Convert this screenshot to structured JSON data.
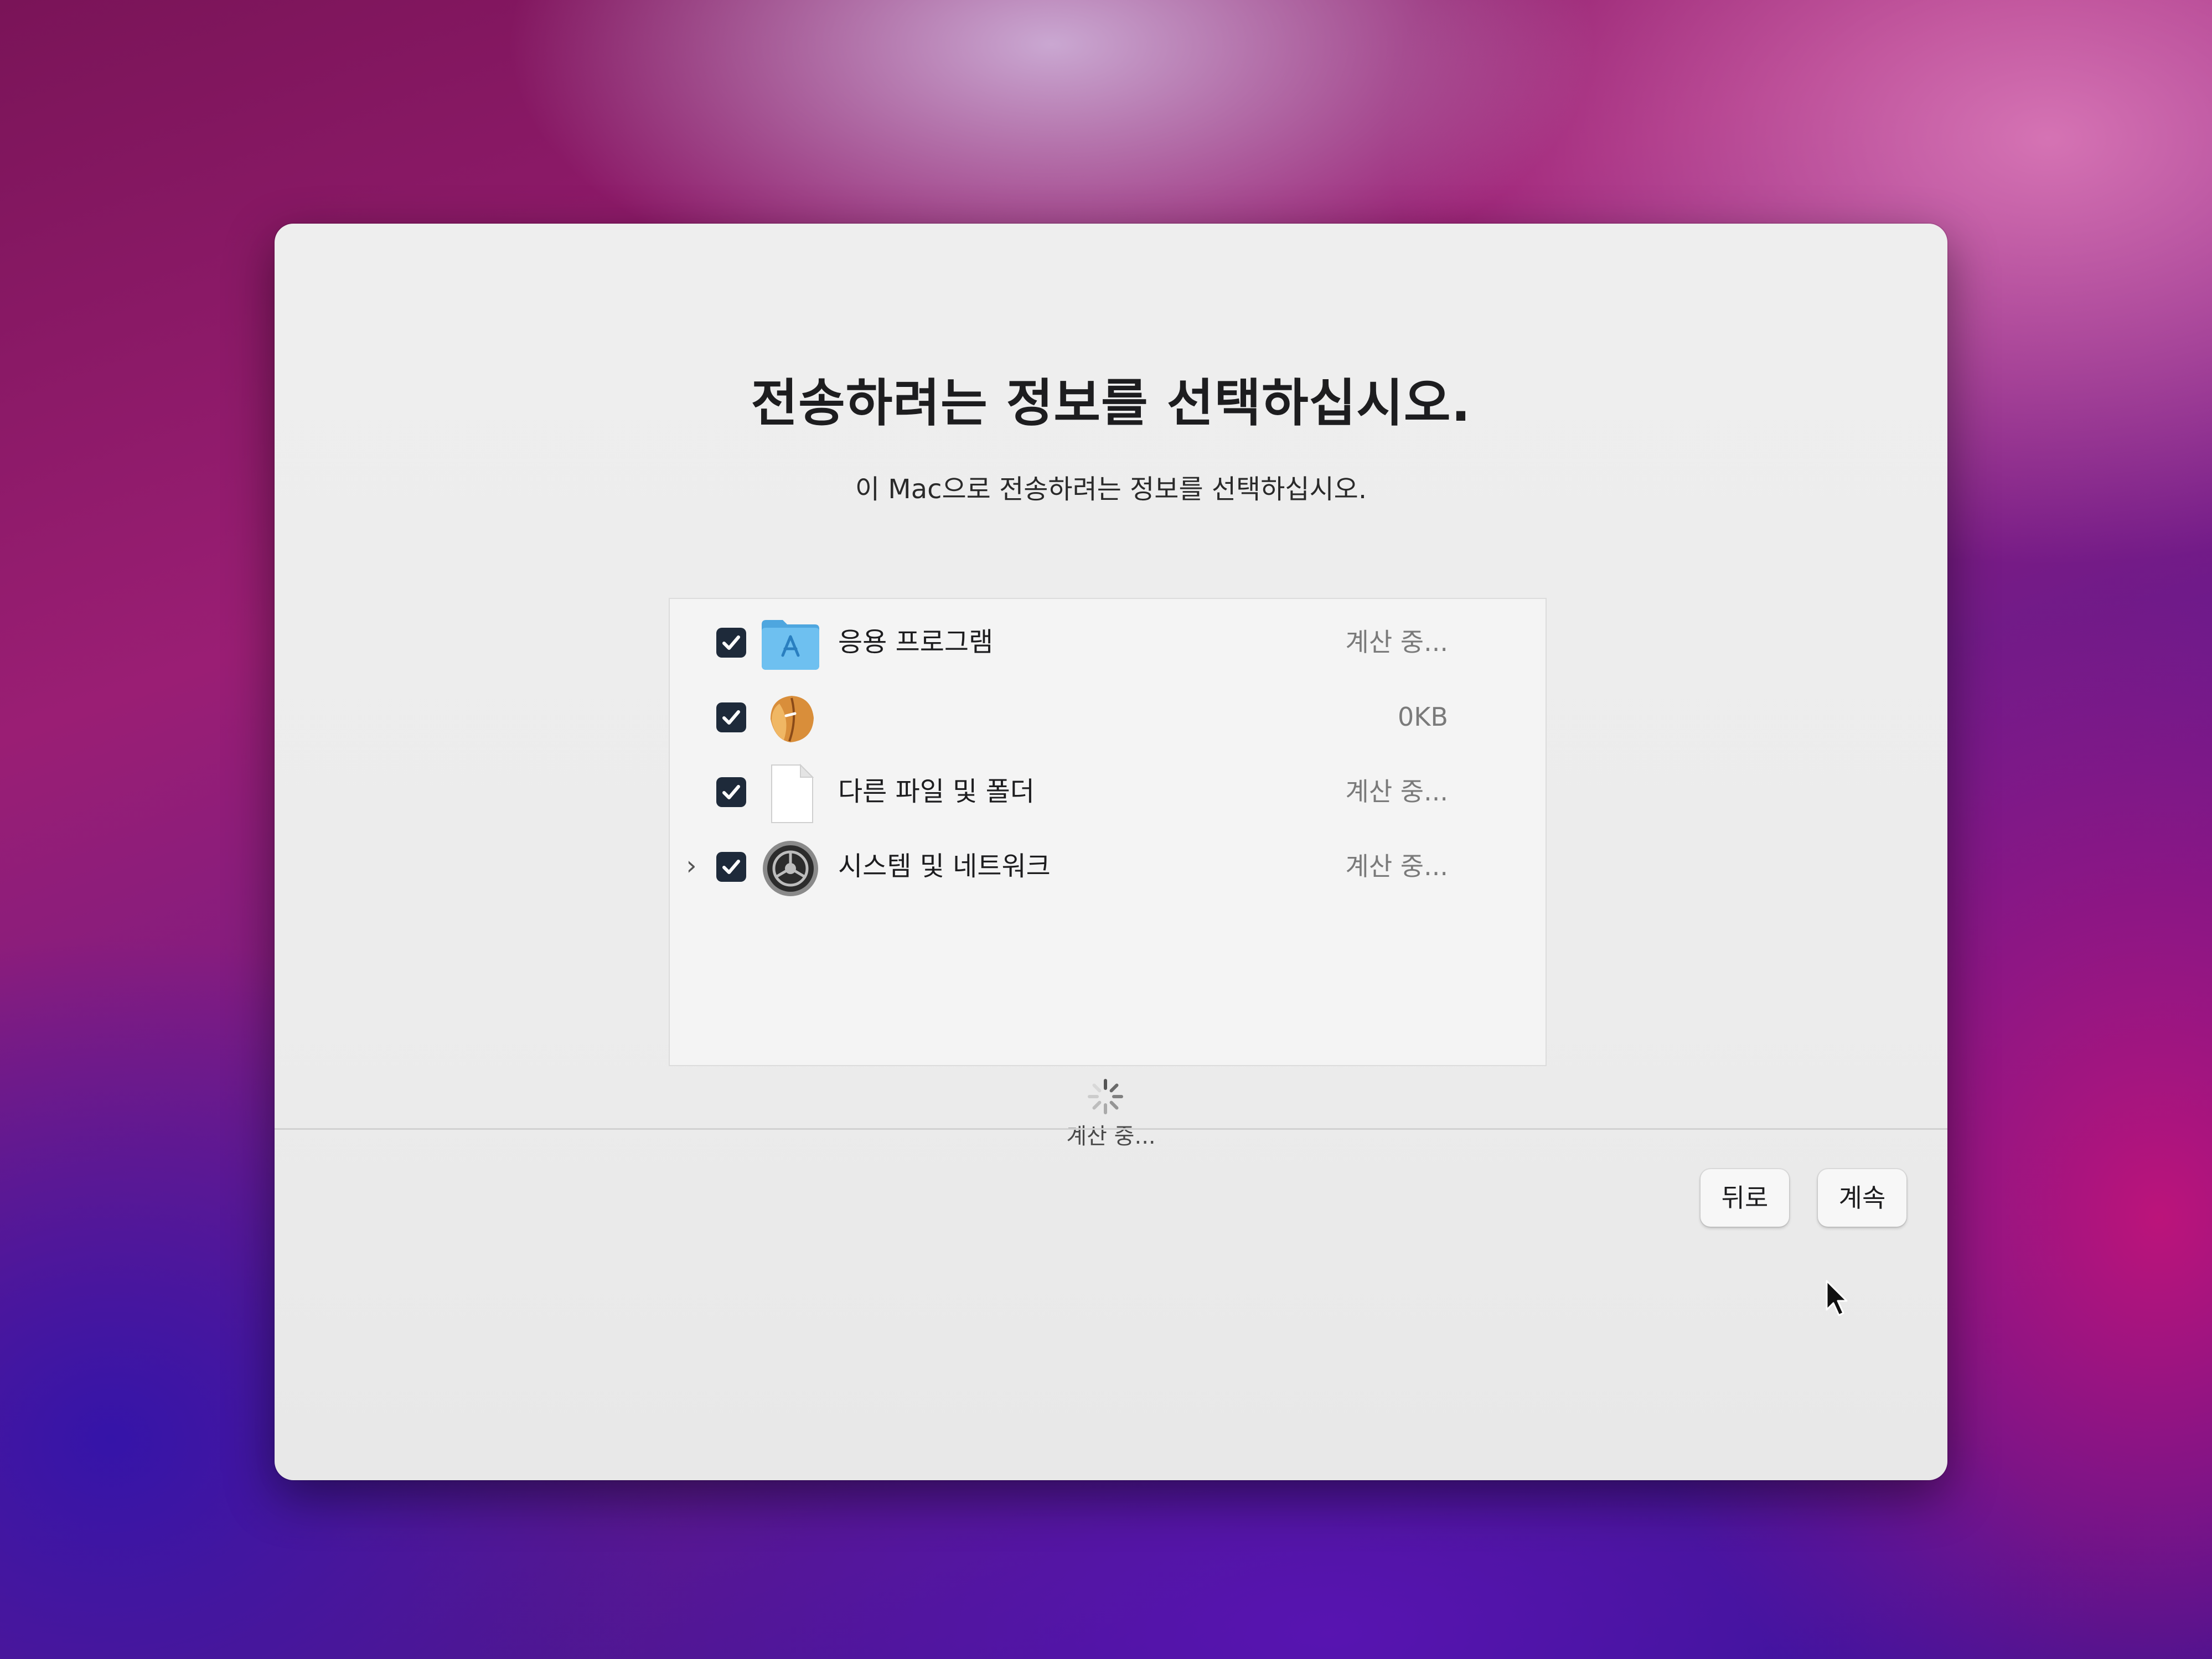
{
  "dialog": {
    "title": "전송하려는 정보를 선택하십시오.",
    "subtitle": "이 Mac으로 전송하려는 정보를 선택하십시오."
  },
  "items": [
    {
      "label": "응용 프로그램",
      "size": "계산 중...",
      "checked": true,
      "icon": "applications-folder-icon"
    },
    {
      "label": "",
      "size": "0KB",
      "checked": true,
      "icon": "fortune-cookie-icon"
    },
    {
      "label": "다른 파일 및 폴더",
      "size": "계산 중...",
      "checked": true,
      "icon": "document-icon"
    },
    {
      "label": "시스템 및 네트워크",
      "size": "계산 중...",
      "checked": true,
      "icon": "system-settings-icon",
      "expandable": true
    }
  ],
  "status": {
    "text": "계산 중..."
  },
  "buttons": {
    "back": "뒤로",
    "continue": "계속"
  },
  "colors": {
    "checkbox": "#1e2a3a",
    "folder": "#5fb4ea"
  }
}
